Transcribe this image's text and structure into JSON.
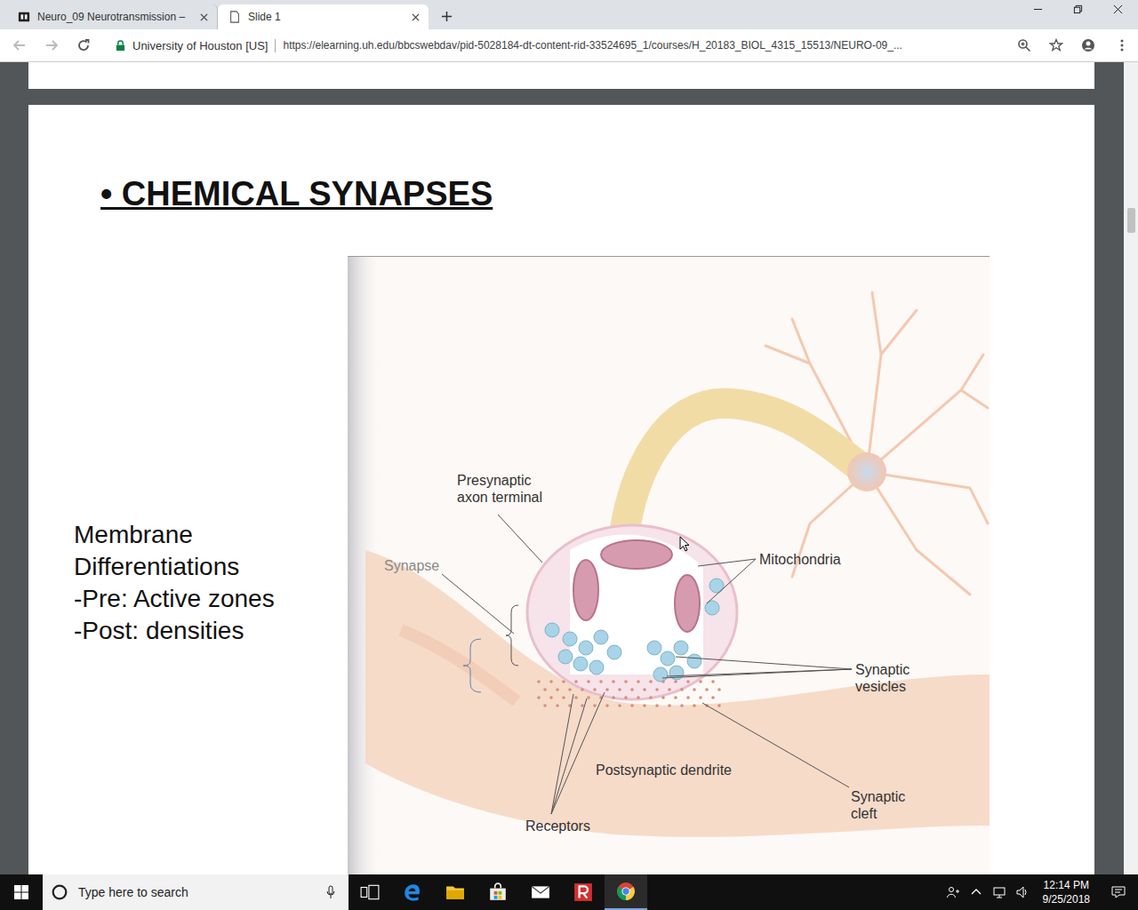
{
  "browser": {
    "tabs": [
      {
        "label": "Neuro_09 Neurotransmission –",
        "selected": false
      },
      {
        "label": "Slide 1",
        "selected": true
      }
    ]
  },
  "address_bar": {
    "site": "University of Houston [US]",
    "url": "https://elearning.uh.edu/bbcswebdav/pid-5028184-dt-content-rid-33524695_1/courses/H_20183_BIOL_4315_15513/NEURO-09_..."
  },
  "slide": {
    "title": "• CHEMICAL SYNAPSES",
    "notes": [
      "Membrane",
      "Differentiations",
      "-Pre: Active zones",
      "-Post: densities"
    ],
    "figure": {
      "labels": [
        {
          "name": "presynaptic-label",
          "lines": [
            "Presynaptic",
            "axon terminal"
          ],
          "muted": false
        },
        {
          "name": "synapse-label",
          "lines": [
            "Synapse"
          ],
          "muted": true
        },
        {
          "name": "mitochondria-label",
          "lines": [
            "Mitochondria"
          ],
          "muted": false
        },
        {
          "name": "vesicles-label",
          "lines": [
            "Synaptic",
            "vesicles"
          ],
          "muted": false
        },
        {
          "name": "dendrite-label",
          "lines": [
            "Postsynaptic dendrite"
          ],
          "muted": false
        },
        {
          "name": "cleft-label",
          "lines": [
            "Synaptic",
            "cleft"
          ],
          "muted": false
        },
        {
          "name": "receptors-label",
          "lines": [
            "Receptors"
          ],
          "muted": false
        }
      ]
    }
  },
  "taskbar": {
    "search_placeholder": "Type here to search",
    "time": "12:14 PM",
    "date": "9/25/2018"
  }
}
